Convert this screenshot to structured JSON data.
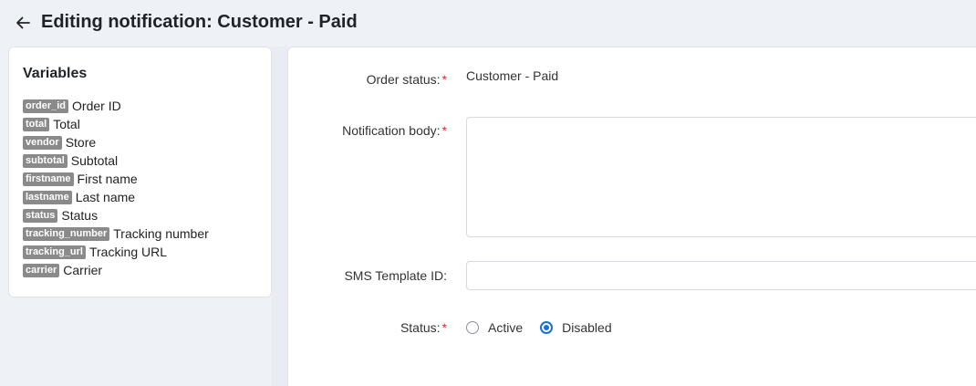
{
  "header": {
    "back_icon": "arrow-left-icon",
    "title": "Editing notification: Customer - Paid"
  },
  "variables": {
    "title": "Variables",
    "items": [
      {
        "tag": "order_id",
        "label": "Order ID"
      },
      {
        "tag": "total",
        "label": "Total"
      },
      {
        "tag": "vendor",
        "label": "Store"
      },
      {
        "tag": "subtotal",
        "label": "Subtotal"
      },
      {
        "tag": "firstname",
        "label": "First name"
      },
      {
        "tag": "lastname",
        "label": "Last name"
      },
      {
        "tag": "status",
        "label": "Status"
      },
      {
        "tag": "tracking_number",
        "label": "Tracking number"
      },
      {
        "tag": "tracking_url",
        "label": "Tracking URL"
      },
      {
        "tag": "carrier",
        "label": "Carrier"
      }
    ]
  },
  "form": {
    "order_status_label": "Order status:",
    "order_status_value": "Customer - Paid",
    "body_label": "Notification body:",
    "body_value": "",
    "sms_label": "SMS Template ID:",
    "sms_value": "",
    "status_label": "Status:",
    "status_options": [
      {
        "label": "Active",
        "checked": false
      },
      {
        "label": "Disabled",
        "checked": true
      }
    ],
    "required_mark": "*"
  },
  "colors": {
    "accent": "#1a6fd1",
    "required": "#d12b2b",
    "tag_bg": "#8a8a8a",
    "page_bg": "#eef1f6"
  }
}
